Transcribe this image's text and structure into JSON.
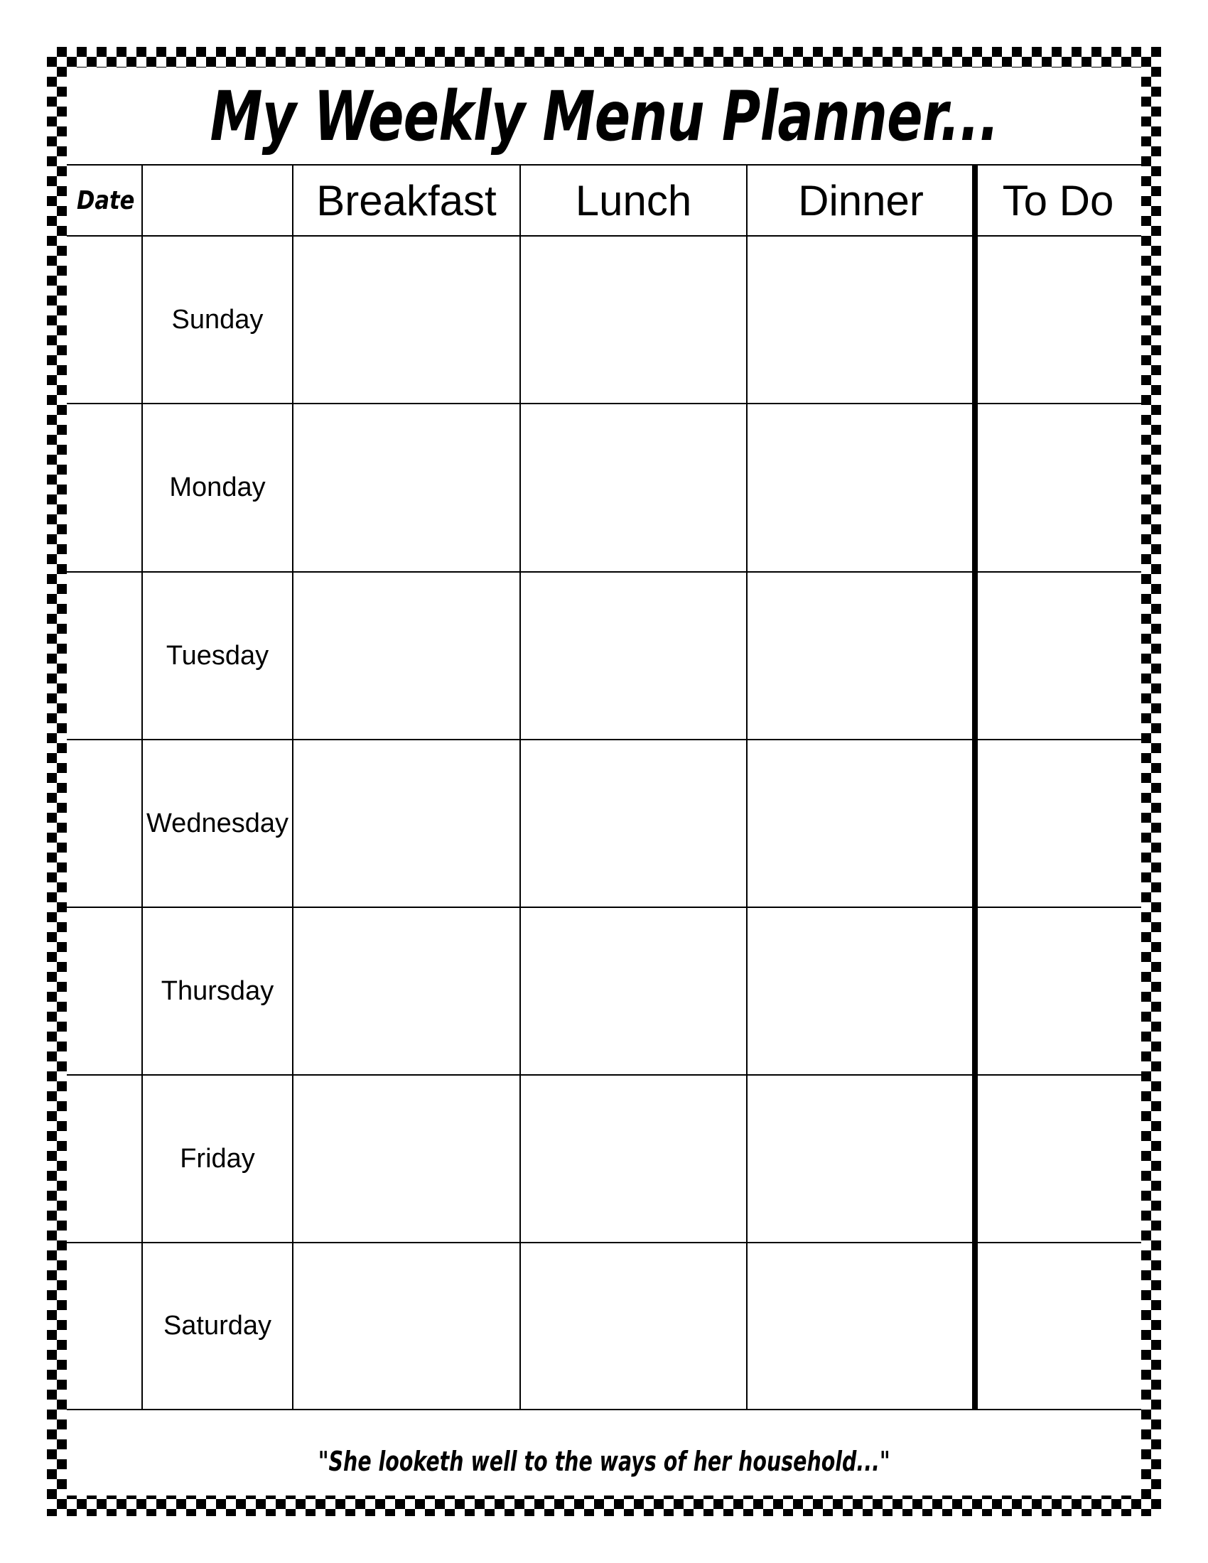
{
  "document": {
    "title": "My Weekly Menu Planner...",
    "footer_quote": "\"She looketh well to the ways of her household...\""
  },
  "table": {
    "columns": [
      {
        "key": "date",
        "label": "Date"
      },
      {
        "key": "day",
        "label": ""
      },
      {
        "key": "breakfast",
        "label": "Breakfast"
      },
      {
        "key": "lunch",
        "label": "Lunch"
      },
      {
        "key": "dinner",
        "label": "Dinner"
      },
      {
        "key": "todo",
        "label": "To Do"
      }
    ],
    "rows": [
      {
        "day": "Sunday",
        "date": "",
        "breakfast": "",
        "lunch": "",
        "dinner": "",
        "todo": ""
      },
      {
        "day": "Monday",
        "date": "",
        "breakfast": "",
        "lunch": "",
        "dinner": "",
        "todo": ""
      },
      {
        "day": "Tuesday",
        "date": "",
        "breakfast": "",
        "lunch": "",
        "dinner": "",
        "todo": ""
      },
      {
        "day": "Wednesday",
        "date": "",
        "breakfast": "",
        "lunch": "",
        "dinner": "",
        "todo": ""
      },
      {
        "day": "Thursday",
        "date": "",
        "breakfast": "",
        "lunch": "",
        "dinner": "",
        "todo": ""
      },
      {
        "day": "Friday",
        "date": "",
        "breakfast": "",
        "lunch": "",
        "dinner": "",
        "todo": ""
      },
      {
        "day": "Saturday",
        "date": "",
        "breakfast": "",
        "lunch": "",
        "dinner": "",
        "todo": ""
      }
    ]
  },
  "colors": {
    "ink": "#000000",
    "paper": "#ffffff"
  }
}
